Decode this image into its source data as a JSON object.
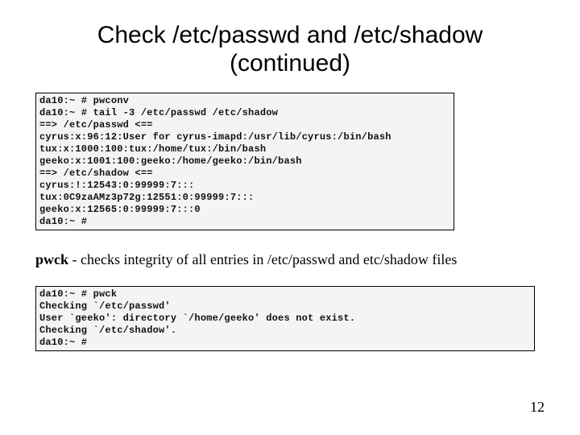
{
  "title_line1": "Check /etc/passwd and /etc/shadow",
  "title_line2": "(continued)",
  "terminal1": "da10:~ # pwconv\nda10:~ # tail -3 /etc/passwd /etc/shadow\n==> /etc/passwd <==\ncyrus:x:96:12:User for cyrus-imapd:/usr/lib/cyrus:/bin/bash\ntux:x:1000:100:tux:/home/tux:/bin/bash\ngeeko:x:1001:100:geeko:/home/geeko:/bin/bash\n==> /etc/shadow <==\ncyrus:!:12543:0:99999:7:::\ntux:0C9zaAMz3p72g:12551:0:99999:7:::\ngeeko:x:12565:0:99999:7:::0\nda10:~ #",
  "desc": {
    "cmd": "pwck",
    "rest": "  - checks integrity of all entries in /etc/passwd and etc/shadow files"
  },
  "terminal2": "da10:~ # pwck\nChecking `/etc/passwd'\nUser `geeko': directory `/home/geeko' does not exist.\nChecking `/etc/shadow'.\nda10:~ #",
  "page_number": "12"
}
